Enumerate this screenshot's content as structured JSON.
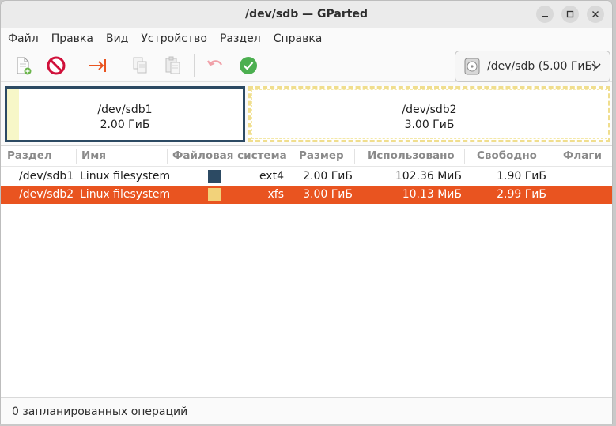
{
  "window": {
    "title": "/dev/sdb — GParted"
  },
  "menu": [
    "Файл",
    "Правка",
    "Вид",
    "Устройство",
    "Раздел",
    "Справка"
  ],
  "device_selector": {
    "label": "/dev/sdb (5.00 ГиБ)"
  },
  "disk_map": {
    "partitions": [
      {
        "name": "/dev/sdb1",
        "size": "2.00 ГиБ",
        "color": "#2c4a63"
      },
      {
        "name": "/dev/sdb2",
        "size": "3.00 ГиБ",
        "color": "#f0de8e"
      }
    ]
  },
  "table": {
    "headers": [
      "Раздел",
      "Имя",
      "Файловая система",
      "Размер",
      "Использовано",
      "Свободно",
      "Флаги"
    ],
    "rows": [
      {
        "partition": "/dev/sdb1",
        "name": "Linux filesystem",
        "fs_color": "#2c4a63",
        "fs": "ext4",
        "size": "2.00 ГиБ",
        "used": "102.36 МиБ",
        "free": "1.90 ГиБ",
        "flags": ""
      },
      {
        "partition": "/dev/sdb2",
        "name": "Linux filesystem",
        "fs_color": "#f2d27a",
        "fs": "xfs",
        "size": "3.00 ГиБ",
        "used": "10.13 МиБ",
        "free": "2.99 ГиБ",
        "flags": ""
      }
    ]
  },
  "status": {
    "text": "0 запланированных операций"
  },
  "colors": {
    "accent": "#e95420",
    "ok_green": "#4caf50",
    "delete_red": "#d0103a"
  }
}
